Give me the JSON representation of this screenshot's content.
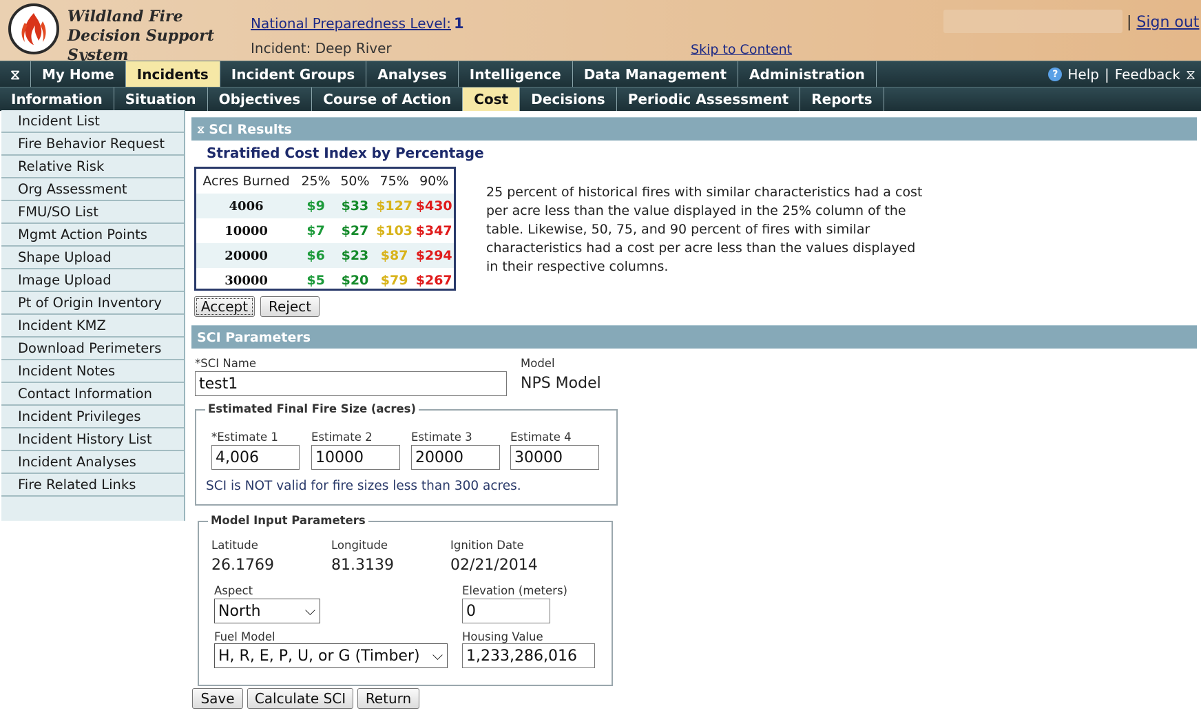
{
  "header": {
    "app_name_line1": "Wildland Fire",
    "app_name_line2": "Decision Support System",
    "npl_label": "National Preparedness Level:",
    "npl_value": "1",
    "incident_label": "Incident:",
    "incident_name": "Deep River",
    "skip_link": "Skip to Content",
    "signout_sep": "|",
    "signout": "Sign out"
  },
  "nav_primary": {
    "tabs": [
      "My Home",
      "Incidents",
      "Incident Groups",
      "Analyses",
      "Intelligence",
      "Data Management",
      "Administration"
    ],
    "active": "Incidents",
    "help": "Help",
    "help_sep": "|",
    "feedback": "Feedback"
  },
  "nav_secondary": {
    "tabs": [
      "Information",
      "Situation",
      "Objectives",
      "Course of Action",
      "Cost",
      "Decisions",
      "Periodic Assessment",
      "Reports"
    ],
    "active": "Cost"
  },
  "sidebar": {
    "items": [
      "Incident List",
      "Fire Behavior Request",
      "Relative Risk",
      "Org Assessment",
      "FMU/SO List",
      "Mgmt Action Points",
      "Shape Upload",
      "Image Upload",
      "Pt of Origin Inventory",
      "Incident KMZ",
      "Download Perimeters",
      "Incident Notes",
      "Contact Information",
      "Incident Privileges",
      "Incident History List",
      "Incident Analyses",
      "Fire Related Links"
    ]
  },
  "results": {
    "section_title": "SCI Results",
    "caption": "Stratified Cost Index by Percentage",
    "columns": [
      "Acres Burned",
      "25%",
      "50%",
      "75%",
      "90%"
    ],
    "rows": [
      [
        "4006",
        "$9",
        "$33",
        "$127",
        "$430"
      ],
      [
        "10000",
        "$7",
        "$27",
        "$103",
        "$347"
      ],
      [
        "20000",
        "$6",
        "$23",
        "$87",
        "$294"
      ],
      [
        "30000",
        "$5",
        "$20",
        "$79",
        "$267"
      ]
    ],
    "explanation": "25 percent of historical fires with similar characteristics had a cost per acre less than the value displayed in the 25% column of the table. Likewise, 50, 75, and 90 percent of fires with similar characteristics had a cost per acre less than the values displayed in their respective columns.",
    "accept": "Accept",
    "reject": "Reject"
  },
  "params": {
    "section_title": "SCI Parameters",
    "sci_name_label": "*SCI Name",
    "sci_name_value": "test1",
    "model_label": "Model",
    "model_value": "NPS Model",
    "fire_size_legend": "Estimated Final Fire Size (acres)",
    "estimates": [
      {
        "label": "*Estimate 1",
        "value": "4,006"
      },
      {
        "label": "Estimate 2",
        "value": "10000"
      },
      {
        "label": "Estimate 3",
        "value": "20000"
      },
      {
        "label": "Estimate 4",
        "value": "30000"
      }
    ],
    "validity_note": "SCI is NOT valid for fire sizes less than 300 acres.",
    "model_input_legend": "Model Input Parameters",
    "latitude_label": "Latitude",
    "latitude_value": "26.1769",
    "longitude_label": "Longitude",
    "longitude_value": "81.3139",
    "ignition_label": "Ignition Date",
    "ignition_value": "02/21/2014",
    "aspect_label": "Aspect",
    "aspect_value": "North",
    "elevation_label": "Elevation (meters)",
    "elevation_value": "0",
    "fuel_label": "Fuel Model",
    "fuel_value": "H, R, E, P, U, or G (Timber)",
    "housing_label": "Housing Value",
    "housing_value": "1,233,286,016"
  },
  "actions": {
    "save": "Save",
    "calculate": "Calculate SCI",
    "return": "Return"
  },
  "icons": {
    "logo": "flame-logo-icon",
    "help": "help-circle-icon",
    "corner": "collapse-icon"
  }
}
